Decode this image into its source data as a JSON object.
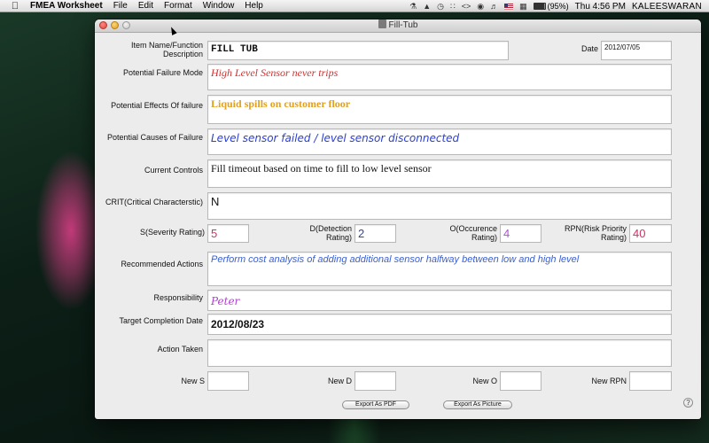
{
  "menubar": {
    "app_name": "FMEA Worksheet",
    "menus": [
      "File",
      "Edit",
      "Format",
      "Window",
      "Help"
    ],
    "battery": "(95%)",
    "clock": "Thu 4:56 PM",
    "user": "KALEESWARAN"
  },
  "window": {
    "title": "Fill-Tub"
  },
  "form": {
    "item_name_label": "Item Name/Function Description",
    "item_name_value": "FILL TUB",
    "date_label": "Date",
    "date_value": "2012/07/05",
    "failure_mode_label": "Potential Failure Mode",
    "failure_mode_value": "High Level Sensor never trips",
    "effects_label": "Potential Effects Of failure",
    "effects_value": "Liquid spills on customer floor",
    "causes_label": "Potential Causes of Failure",
    "causes_value": "Level sensor failed / level sensor disconnected",
    "controls_label": "Current Controls",
    "controls_value": "Fill timeout based on time to fill to low level sensor",
    "crit_label": "CRIT(Critical Characterstic)",
    "crit_value": "N",
    "s_label": "S(Severity Rating)",
    "s_value": "5",
    "d_label": "D(Detection Rating)",
    "d_value": "2",
    "o_label": "O(Occurence Rating)",
    "o_value": "4",
    "rpn_label": "RPN(Risk Priority Rating)",
    "rpn_value": "40",
    "recommended_label": "Recommended Actions",
    "recommended_value": "Perform cost analysis of adding additional sensor halfway between low and high level",
    "responsibility_label": "Responsibility",
    "responsibility_value": "Peter",
    "target_label": "Target Completion Date",
    "target_value": "2012/08/23",
    "action_taken_label": "Action Taken",
    "action_taken_value": "",
    "new_s_label": "New S",
    "new_s_value": "",
    "new_d_label": "New D",
    "new_d_value": "",
    "new_o_label": "New O",
    "new_o_value": "",
    "new_rpn_label": "New RPN",
    "new_rpn_value": ""
  },
  "buttons": {
    "export_pdf": "Export As PDF",
    "export_picture": "Export As Picture",
    "help": "?"
  },
  "colors": {
    "failure_mode": "#d03030",
    "effects": "#e0a020",
    "causes": "#2a3fd0",
    "rating_s": "#d0306a",
    "rating_d": "#2a3fd0",
    "rating_o": "#b050d8",
    "rating_rpn": "#d0306a",
    "recommended": "#3a5fd0",
    "responsibility": "#b040d0"
  }
}
